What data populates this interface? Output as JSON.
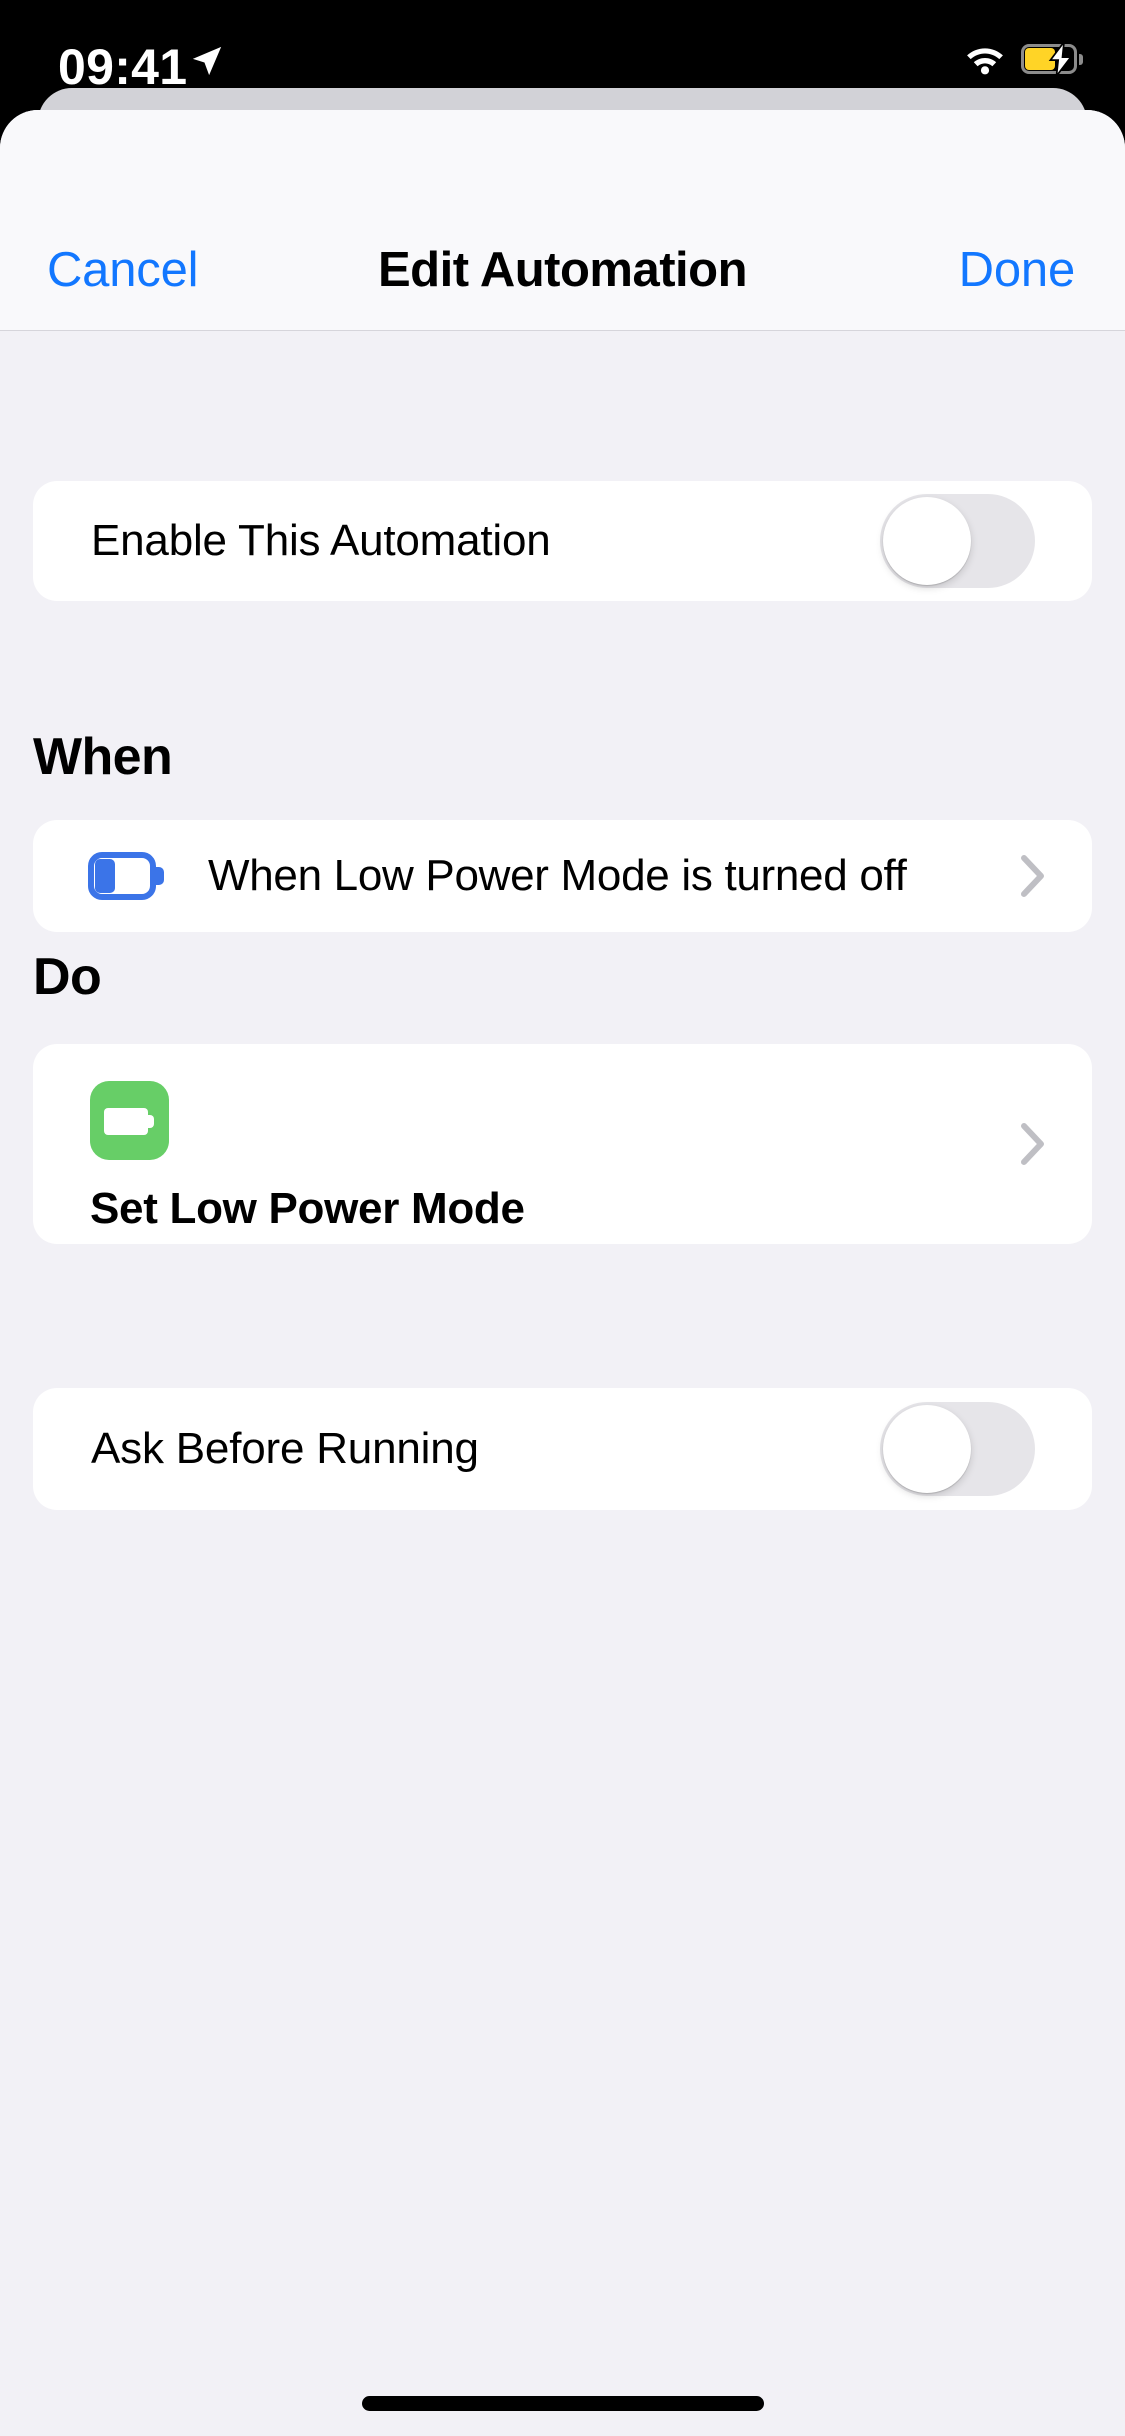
{
  "status_bar": {
    "time": "09:41",
    "location_icon": "location-arrow-icon",
    "wifi_icon": "wifi-icon",
    "battery_icon": "battery-charging-icon"
  },
  "navbar": {
    "cancel_label": "Cancel",
    "title": "Edit Automation",
    "done_label": "Done"
  },
  "enable_row": {
    "label": "Enable This Automation",
    "toggle_state": "off"
  },
  "when_section": {
    "header": "When",
    "trigger": {
      "icon": "battery-low-icon",
      "label": "When Low Power Mode is turned off",
      "accessory": "chevron-right-icon"
    }
  },
  "do_section": {
    "header": "Do",
    "action": {
      "icon": "battery-green-icon",
      "title": "Set Low Power Mode",
      "accessory": "chevron-right-icon"
    }
  },
  "ask_row": {
    "label": "Ask Before Running",
    "toggle_state": "off"
  },
  "colors": {
    "accent_blue": "#1277FF",
    "trigger_icon_blue": "#3B74E8",
    "action_icon_green": "#67CE67",
    "page_background": "#F2F1F6",
    "card_background": "#FFFFFF",
    "navbar_background": "#F9F9FB",
    "toggle_off_track": "#E6E5E9",
    "battery_charging_yellow": "#FFD426"
  }
}
